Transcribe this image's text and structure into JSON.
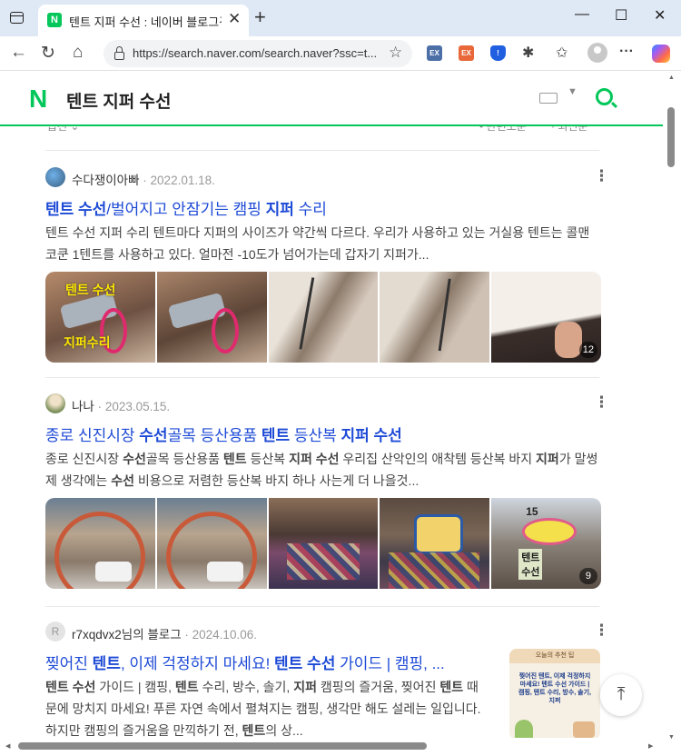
{
  "browser": {
    "tab_title": "텐트 지퍼 수선 : 네이버 블로그검",
    "url": "https://search.naver.com/search.naver?ssc=t...",
    "ext_labels": [
      "EX",
      "EX"
    ]
  },
  "header": {
    "logo": "N",
    "query": "텐트 지퍼 수선"
  },
  "sort": {
    "left": "옵션 ⌄",
    "right1": "• 관련도순",
    "right2": "· 최신순"
  },
  "posts": [
    {
      "author": "수다쟁이아빠",
      "date": "· 2022.01.18.",
      "title_parts": [
        [
          "텐트 수선",
          true
        ],
        [
          "/벌어지고 안잠기는 캠핑 ",
          false
        ],
        [
          "지퍼",
          true
        ],
        [
          " 수리",
          false
        ]
      ],
      "desc": "텐트 수선 지퍼 수리 텐트마다 지퍼의 사이즈가 약간씩 다르다. 우리가 사용하고 있는 거실용 텐트는 콜맨 코쿤 1텐트를 사용하고 있다. 얼마전 -10도가 넘어가는데 갑자기 지퍼가...",
      "thumb_caption_1": "텐트 수선",
      "thumb_caption_2": "지퍼수리",
      "image_count": "12"
    },
    {
      "author": "나나",
      "date": "· 2023.05.15.",
      "title_parts": [
        [
          "종로 신진시장 ",
          false
        ],
        [
          "수선",
          true
        ],
        [
          "골목 등산용품 ",
          false
        ],
        [
          "텐트",
          true
        ],
        [
          " 등산복 ",
          false
        ],
        [
          "지퍼 수선",
          true
        ]
      ],
      "desc_parts": [
        [
          "종로 신진시장 ",
          false
        ],
        [
          "수선",
          true
        ],
        [
          "골목 등산용품 ",
          false
        ],
        [
          "텐트",
          true
        ],
        [
          " 등산복 ",
          false
        ],
        [
          "지퍼 수선",
          true
        ],
        [
          " 우리집 산악인의 애착템 등산복 바지 ",
          false
        ],
        [
          "지퍼",
          true
        ],
        [
          "가 말썽 제 생각에는 ",
          false
        ],
        [
          "수선",
          true
        ],
        [
          " 비용으로 저렴한 등산복 바지 하나 사는게 더 나을것...",
          false
        ]
      ],
      "image_count": "9",
      "sign_text": "15",
      "sign_text_2": "텐트\n수선"
    },
    {
      "author": "r7xqdvx2님의 블로그",
      "date": "· 2024.10.06.",
      "avatar_letter": "R",
      "title_parts": [
        [
          "찢어진 ",
          false
        ],
        [
          "텐트",
          true
        ],
        [
          ", 이제 걱정하지 마세요! ",
          false
        ],
        [
          "텐트 수선",
          true
        ],
        [
          " 가이드 | 캠핑, ...",
          false
        ]
      ],
      "desc_parts": [
        [
          "텐트 수선",
          true
        ],
        [
          " 가이드 | 캠핑, ",
          false
        ],
        [
          "텐트",
          true
        ],
        [
          " 수리, 방수, 솔기, ",
          false
        ],
        [
          "지퍼",
          true
        ],
        [
          " 캠핑의 즐거움, 찢어진 ",
          false
        ],
        [
          "텐트",
          true
        ],
        [
          " 때문에 망치지 마세요! 푸른 자연 속에서 펼쳐지는 캠핑, 생각만 해도 설레는 일입니다. 하지만 캠핑의 즐거움을 만끽하기 전, ",
          false
        ],
        [
          "텐트",
          true
        ],
        [
          "의 상...",
          false
        ]
      ],
      "side_title": "오늘의 추천 팁",
      "side_text": "찢어진 텐트, 이제 걱정하지 마세요! 텐트 수선 가이드 | 캠핑, 텐트 수리, 방수, 솔기, 지퍼"
    }
  ],
  "colors": {
    "brand": "#03c75a",
    "link": "#1d4ad6"
  }
}
